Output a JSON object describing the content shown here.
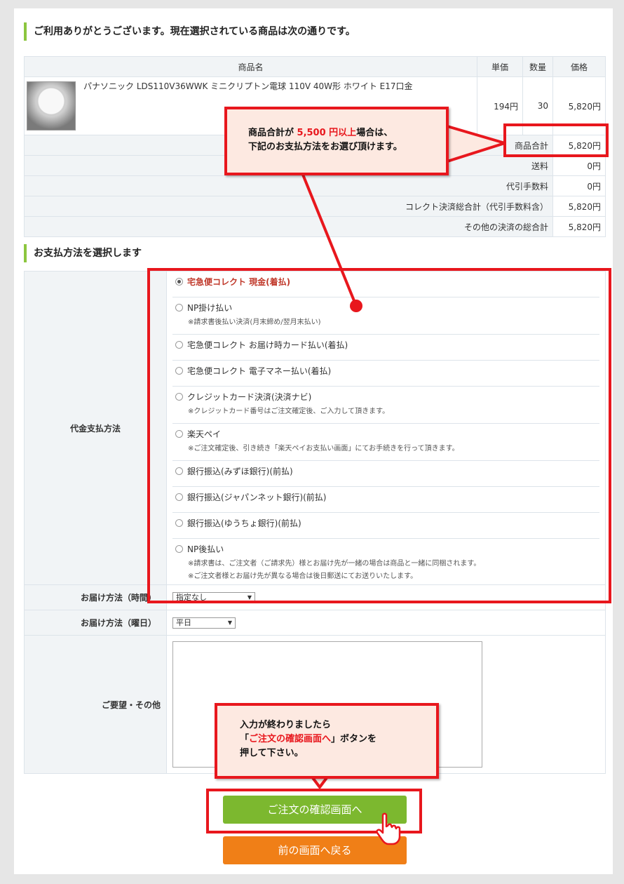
{
  "header": {
    "title": "ご利用ありがとうございます。現在選択されている商品は次の通りです。"
  },
  "cart": {
    "columns": [
      "商品名",
      "単価",
      "数量",
      "価格"
    ],
    "item": {
      "name": "パナソニック LDS110V36WWK ミニクリプトン電球 110V 40W形 ホワイト E17口金",
      "unit_price": "194円",
      "quantity": "30",
      "price": "5,820円"
    },
    "summary": [
      {
        "label": "商品合計",
        "value": "5,820円"
      },
      {
        "label": "送料",
        "value": "0円"
      },
      {
        "label": "代引手数料",
        "value": "0円"
      },
      {
        "label": "コレクト決済総合計（代引手数料含）",
        "value": "5,820円"
      },
      {
        "label": "その他の決済の総合計",
        "value": "5,820円"
      }
    ]
  },
  "payment_section": {
    "title": "お支払方法を選択します",
    "label": "代金支払方法"
  },
  "payment_options": [
    {
      "label": "宅急便コレクト 現金(着払)",
      "note": "",
      "selected": true
    },
    {
      "label": "NP掛け払い",
      "note": "※請求書後払い決済(月末締め/翌月末払い)"
    },
    {
      "label": "宅急便コレクト お届け時カード払い(着払)",
      "note": ""
    },
    {
      "label": "宅急便コレクト 電子マネー払い(着払)",
      "note": ""
    },
    {
      "label": "クレジットカード決済(決済ナビ)",
      "note": "※クレジットカード番号はご注文確定後、ご入力して頂きます。"
    },
    {
      "label": "楽天ペイ",
      "note": "※ご注文確定後、引き続き「楽天ペイお支払い画面」にてお手続きを行って頂きます。"
    },
    {
      "label": "銀行振込(みずほ銀行)(前払)",
      "note": ""
    },
    {
      "label": "銀行振込(ジャパンネット銀行)(前払)",
      "note": ""
    },
    {
      "label": "銀行振込(ゆうちょ銀行)(前払)",
      "note": ""
    },
    {
      "label": "NP後払い",
      "note": "※請求書は、ご注文者（ご請求先）様とお届け先が一緒の場合は商品と一緒に同梱されます。",
      "note2": "※ご注文者様とお届け先が異なる場合は後日郵送にてお送りいたします。"
    }
  ],
  "delivery": {
    "time_label": "お届け方法（時間）",
    "time_value": "指定なし",
    "day_label": "お届け方法（曜日）",
    "day_value": "平日",
    "request_label": "ご要望・その他"
  },
  "callout1": {
    "line1_a": "商品合計が ",
    "line1_b": "5,500 円以上",
    "line1_c": "場合は、",
    "line2": "下記のお支払方法をお選び頂けます。"
  },
  "callout2": {
    "line1": "入力が終わりましたら",
    "line2_a": "「",
    "line2_b": "ご注文の確認画面へ",
    "line2_c": "」ボタンを",
    "line3": "押して下さい。"
  },
  "buttons": {
    "confirm": "ご注文の確認画面へ",
    "back": "前の画面へ戻る"
  },
  "colors": {
    "accent_green": "#8cc63f",
    "button_green": "#7cb82f",
    "button_orange": "#f07f17",
    "highlight_red": "#e8171d",
    "selected_text": "#c0392b"
  }
}
